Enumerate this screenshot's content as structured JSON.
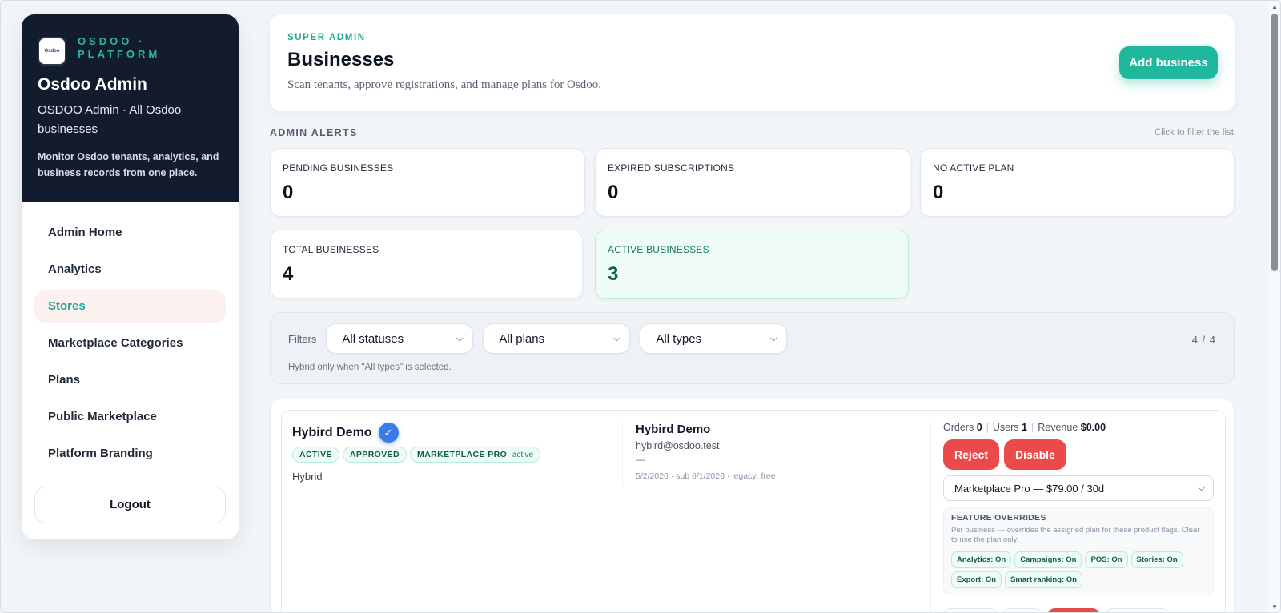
{
  "sidebar": {
    "logo_text": "Osdoo",
    "brand_tag": "OSDOO · PLATFORM",
    "title": "Osdoo Admin",
    "subtitle": "OSDOO Admin · All Osdoo businesses",
    "description": "Monitor Osdoo tenants, analytics, and business records from one place.",
    "items": [
      {
        "label": "Admin Home"
      },
      {
        "label": "Analytics"
      },
      {
        "label": "Stores"
      },
      {
        "label": "Marketplace Categories"
      },
      {
        "label": "Plans"
      },
      {
        "label": "Public Marketplace"
      },
      {
        "label": "Platform Branding"
      }
    ],
    "logout": "Logout"
  },
  "header": {
    "eyebrow": "SUPER ADMIN",
    "title": "Businesses",
    "subtitle": "Scan tenants, approve registrations, and manage plans for Osdoo.",
    "add_button": "Add business"
  },
  "alerts": {
    "label": "ADMIN ALERTS",
    "hint": "Click to filter the list",
    "cards": [
      {
        "label": "PENDING BUSINESSES",
        "value": "0"
      },
      {
        "label": "EXPIRED SUBSCRIPTIONS",
        "value": "0"
      },
      {
        "label": "NO ACTIVE PLAN",
        "value": "0"
      },
      {
        "label": "TOTAL BUSINESSES",
        "value": "4"
      },
      {
        "label": "ACTIVE BUSINESSES",
        "value": "3"
      }
    ]
  },
  "filters": {
    "label": "Filters",
    "status": "All statuses",
    "plan": "All plans",
    "type": "All types",
    "count": "4 / 4",
    "note": "Hybrid only when \"All types\" is selected."
  },
  "business": {
    "name": "Hybird Demo",
    "badges": {
      "status": "ACTIVE",
      "approval": "APPROVED",
      "plan": "MARKETPLACE PRO",
      "plan_state": "·active"
    },
    "type": "Hybrid",
    "owner_name": "Hybird Demo",
    "owner_email": "hybird@osdoo.test",
    "owner_phone": "—",
    "meta": "5/2/2026 · sub 6/1/2026 · legacy: free",
    "metrics": {
      "orders_label": "Orders",
      "orders": "0",
      "users_label": "Users",
      "users": "1",
      "revenue_label": "Revenue",
      "revenue": "$0.00"
    },
    "reject": "Reject",
    "disable": "Disable",
    "plan_select": "Marketplace Pro — $79.00 / 30d",
    "overrides": {
      "title": "FEATURE OVERRIDES",
      "desc": "Per business — overrides the assigned plan for these product flags. Clear to use the plan only.",
      "chips": [
        "Analytics: On",
        "Campaigns: On",
        "POS: On",
        "Stories: On",
        "Export: On",
        "Smart ranking: On"
      ]
    }
  },
  "colors": {
    "accent": "#1fb89d",
    "sidebar_bg": "#131c2d",
    "danger": "#ea4a4a",
    "verified": "#3b7be8"
  }
}
